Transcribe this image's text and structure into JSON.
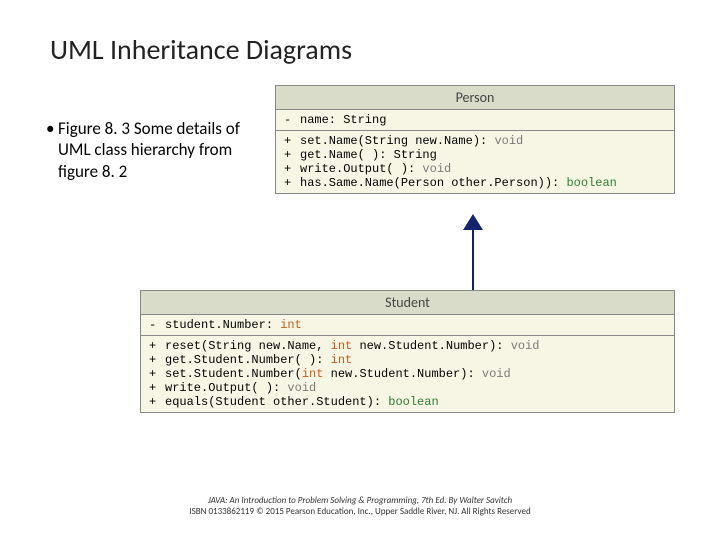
{
  "title": "UML Inheritance Diagrams",
  "bullet": "Figure 8. 3 Some details of UML class hierarchy from figure 8. 2",
  "person": {
    "name": "Person",
    "attrs": [
      {
        "vis": "-",
        "sig": "name: String"
      }
    ],
    "methods": [
      {
        "vis": "+",
        "sig": "set.Name(String new.Name): ",
        "ret": "void",
        "retClass": "kw-void"
      },
      {
        "vis": "+",
        "sig": "get.Name( ): String"
      },
      {
        "vis": "+",
        "sig": "write.Output( ): ",
        "ret": "void",
        "retClass": "kw-void"
      },
      {
        "vis": "+",
        "sig": "has.Same.Name(Person other.Person)): ",
        "ret": "boolean",
        "retClass": "kw-bool"
      }
    ]
  },
  "student": {
    "name": "Student",
    "attrs": [
      {
        "vis": "-",
        "sig": "student.Number: ",
        "ret": "int",
        "retClass": "kw-int"
      }
    ],
    "methods": [
      {
        "vis": "+",
        "sig": "reset(String new.Name, ",
        "mid": "int",
        "midClass": "kw-int",
        "sig2": " new.Student.Number): ",
        "ret": "void",
        "retClass": "kw-void"
      },
      {
        "vis": "+",
        "sig": "get.Student.Number( ): ",
        "ret": "int",
        "retClass": "kw-int"
      },
      {
        "vis": "+",
        "sig": "set.Student.Number(",
        "mid": "int",
        "midClass": "kw-int",
        "sig2": " new.Student.Number): ",
        "ret": "void",
        "retClass": "kw-void"
      },
      {
        "vis": "+",
        "sig": "write.Output( ): ",
        "ret": "void",
        "retClass": "kw-void"
      },
      {
        "vis": "+",
        "sig": "equals(Student other.Student): ",
        "ret": "boolean",
        "retClass": "kw-bool"
      }
    ]
  },
  "footer": {
    "l1": "JAVA: An Introduction to Problem Solving & Programming, 7th Ed. By Walter Savitch",
    "l2": "ISBN 0133862119 © 2015 Pearson Education, Inc., Upper Saddle River, NJ. All Rights Reserved"
  }
}
